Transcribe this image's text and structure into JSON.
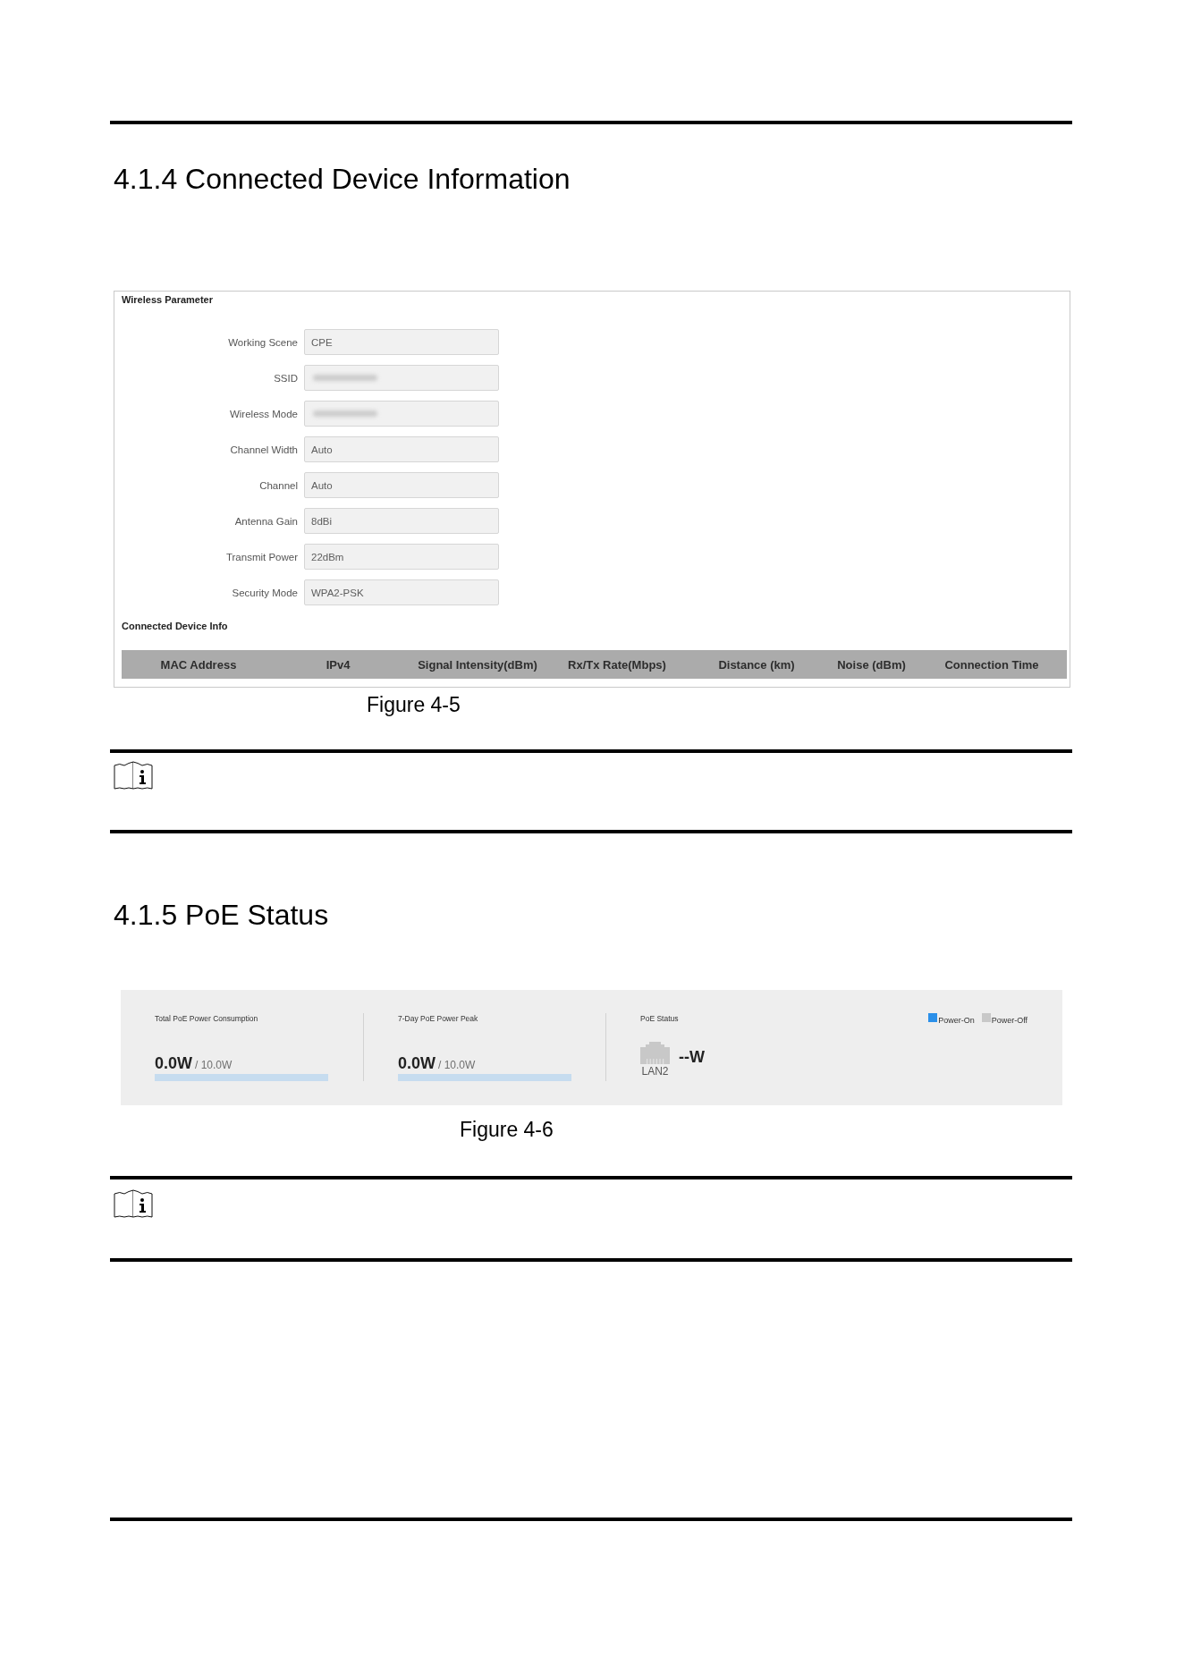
{
  "sections": [
    {
      "kind": "wireless",
      "heading": "4.1.4 Connected Device Information",
      "figure": {
        "wireless_parameter": {
          "title": "Wireless Parameter",
          "fields": [
            {
              "label": "Working Scene",
              "value": "CPE",
              "redacted": false
            },
            {
              "label": "SSID",
              "redacted": true
            },
            {
              "label": "Wireless Mode",
              "redacted": true
            },
            {
              "label": "Channel Width",
              "value": "Auto",
              "redacted": false
            },
            {
              "label": "Channel",
              "value": "Auto",
              "redacted": false
            },
            {
              "label": "Antenna Gain",
              "value": "8dBi",
              "redacted": false
            },
            {
              "label": "Transmit Power",
              "value": "22dBm",
              "redacted": false
            },
            {
              "label": "Security Mode",
              "value": "WPA2-PSK",
              "redacted": false
            }
          ]
        },
        "connected_device_info": {
          "title": "Connected Device Info",
          "columns": [
            "MAC Address",
            "IPv4",
            "Signal Intensity(dBm)",
            "Rx/Tx Rate(Mbps)",
            "Distance (km)",
            "Noise (dBm)",
            "Connection Time"
          ]
        }
      },
      "caption": "Figure 4-5"
    },
    {
      "kind": "poe",
      "heading": "4.1.5 PoE Status",
      "figure": {
        "metrics": [
          {
            "label": "Total PoE Power Consumption",
            "value": "0.0W",
            "max": "/ 10.0W",
            "level": 0
          },
          {
            "label": "7-Day PoE Power Peak",
            "value": "0.0W",
            "max": "/ 10.0W",
            "level": 0
          }
        ],
        "status": {
          "label": "PoE Status",
          "legend": [
            {
              "label": "Power-On",
              "kind": "on",
              "color": "#2b90e9"
            },
            {
              "label": "Power-Off",
              "kind": "off",
              "color": "#c8c8c8"
            }
          ],
          "ports": [
            {
              "name": "LAN2",
              "reading": "--W",
              "powered": false
            }
          ]
        }
      },
      "caption": "Figure 4-6"
    }
  ]
}
